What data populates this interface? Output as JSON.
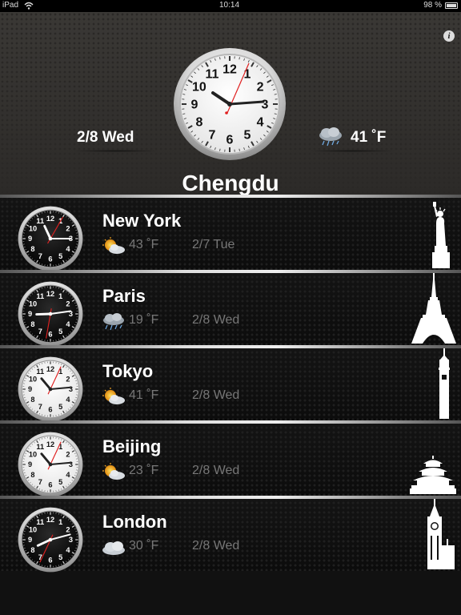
{
  "status_bar": {
    "carrier": "iPad",
    "time": "10:14",
    "battery": "98 %"
  },
  "header": {
    "info_label": "i",
    "date": "2/8 Wed",
    "temperature": "41 ˚F",
    "weather": "rain-cloud-icon",
    "city": "Chengdu",
    "clock_face": "white"
  },
  "cities": [
    {
      "name": "New York",
      "temperature": "43 ˚F",
      "date": "2/7 Tue",
      "weather": "partly-sunny-icon",
      "clock_face": "black",
      "landmark": "statue-of-liberty-icon"
    },
    {
      "name": "Paris",
      "temperature": "19 ˚F",
      "date": "2/8 Wed",
      "weather": "rain-cloud-icon",
      "clock_face": "black",
      "landmark": "eiffel-tower-icon"
    },
    {
      "name": "Tokyo",
      "temperature": "41 ˚F",
      "date": "2/8 Wed",
      "weather": "partly-sunny-icon",
      "clock_face": "white",
      "landmark": "tokyo-tower-icon"
    },
    {
      "name": "Beijing",
      "temperature": "23 ˚F",
      "date": "2/8 Wed",
      "weather": "partly-sunny-icon",
      "clock_face": "white",
      "landmark": "temple-of-heaven-icon"
    },
    {
      "name": "London",
      "temperature": "30 ˚F",
      "date": "2/8 Wed",
      "weather": "cloud-icon",
      "clock_face": "black",
      "landmark": "big-ben-icon"
    }
  ],
  "colors": {
    "accent_red": "#e02020",
    "text_white": "#ffffff",
    "text_gray": "#777777"
  }
}
